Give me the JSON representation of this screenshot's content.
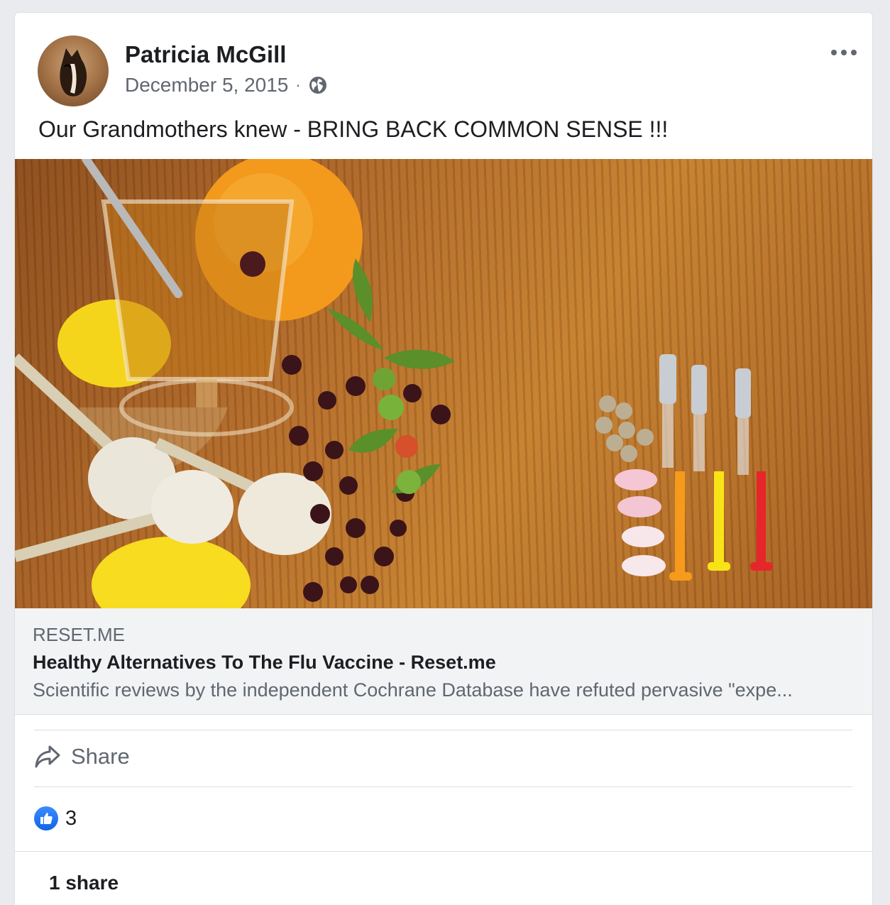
{
  "post": {
    "author": "Patricia McGill",
    "date": "December 5, 2015",
    "separator": "·",
    "privacy_icon": "globe-icon",
    "text": "Our Grandmothers knew - BRING BACK COMMON SENSE !!!"
  },
  "link_preview": {
    "domain": "RESET.ME",
    "title": "Healthy Alternatives To The Flu Vaccine - Reset.me",
    "description": "Scientific reviews by the independent Cochrane Database have refuted pervasive \"expe..."
  },
  "actions": {
    "share_label": "Share",
    "share_icon": "share-arrow-icon"
  },
  "reactions": {
    "icon": "like-icon",
    "count": "3"
  },
  "shares": {
    "label": "1 share"
  },
  "colors": {
    "like_blue": "#1877f2",
    "text_primary": "#1c1e21",
    "text_secondary": "#606770"
  }
}
